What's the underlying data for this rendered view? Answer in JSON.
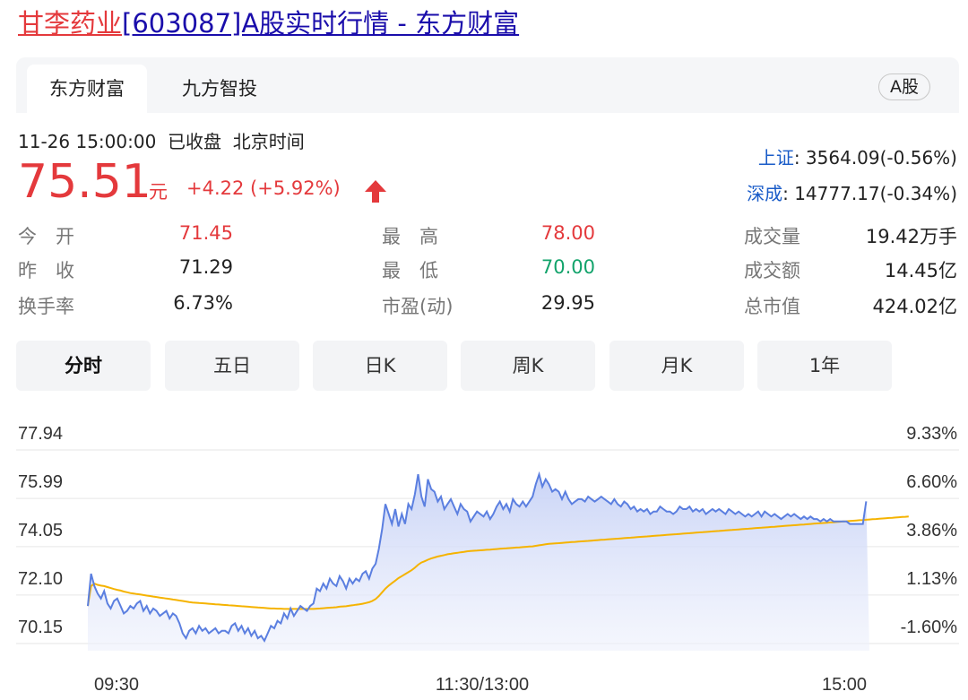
{
  "page_title": {
    "name_part": "甘李药业",
    "rest_part": "[603087]A股实时行情 - 东方财富"
  },
  "tabs": [
    {
      "label": "东方财富",
      "active": true
    },
    {
      "label": "九方智投",
      "active": false
    }
  ],
  "market_badge": "A股",
  "quote": {
    "timestamp": "11-26 15:00:00",
    "status": "已收盘",
    "timezone": "北京时间",
    "price": "75.51",
    "unit": "元",
    "change": "+4.22 (+5.92%)",
    "direction": "up"
  },
  "indices": [
    {
      "name": "上证",
      "value": ": 3564.09(-0.56%)"
    },
    {
      "name": "深成",
      "value": ": 14777.17(-0.34%)"
    }
  ],
  "stats": [
    {
      "label": "今　开",
      "value": "71.45",
      "tone": "red"
    },
    {
      "label": "最　高",
      "value": "78.00",
      "tone": "red"
    },
    {
      "label": "成交量",
      "value": "19.42万手",
      "tone": "normal"
    },
    {
      "label": "昨　收",
      "value": "71.29",
      "tone": "normal"
    },
    {
      "label": "最　低",
      "value": "70.00",
      "tone": "green"
    },
    {
      "label": "成交额",
      "value": "14.45亿",
      "tone": "normal"
    },
    {
      "label": "换手率",
      "value": "6.73%",
      "tone": "normal"
    },
    {
      "label": "市盈(动)",
      "value": "29.95",
      "tone": "normal"
    },
    {
      "label": "总市值",
      "value": "424.02亿",
      "tone": "normal"
    }
  ],
  "period_tabs": [
    {
      "label": "分时",
      "active": true
    },
    {
      "label": "五日",
      "active": false
    },
    {
      "label": "日K",
      "active": false
    },
    {
      "label": "周K",
      "active": false
    },
    {
      "label": "月K",
      "active": false
    },
    {
      "label": "1年",
      "active": false
    }
  ],
  "colors": {
    "up": "#e4393c",
    "down": "#12a36b",
    "price_line": "#5b7fe0",
    "avg_line": "#f5b300",
    "link_blue": "#1a5cc8"
  },
  "chart_data": {
    "type": "line",
    "y_ticks": [
      "77.94",
      "75.99",
      "74.05",
      "72.10",
      "70.15"
    ],
    "y_pct_ticks": [
      "9.33%",
      "6.60%",
      "3.86%",
      "1.13%",
      "-1.60%"
    ],
    "x_ticks": [
      "09:30",
      "11:30/13:00",
      "15:00"
    ],
    "ylim": [
      69.5,
      77.94
    ],
    "prev_close": 71.29,
    "points_count": 240,
    "series": [
      {
        "role": "price",
        "values": [
          71.3,
          72.6,
          72.1,
          71.8,
          71.6,
          71.9,
          71.4,
          71.2,
          71.5,
          71.6,
          71.3,
          71.0,
          71.1,
          71.3,
          71.2,
          71.4,
          71.5,
          71.1,
          71.3,
          71.0,
          71.2,
          71.1,
          70.9,
          71.0,
          71.1,
          70.8,
          71.0,
          70.9,
          70.6,
          70.2,
          70.0,
          70.3,
          70.4,
          70.2,
          70.5,
          70.3,
          70.4,
          70.2,
          70.3,
          70.4,
          70.2,
          70.3,
          70.3,
          70.2,
          70.5,
          70.6,
          70.3,
          70.5,
          70.2,
          70.4,
          70.1,
          70.3,
          70.0,
          70.1,
          69.9,
          70.2,
          70.5,
          70.4,
          70.7,
          70.6,
          71.0,
          70.8,
          71.2,
          70.9,
          71.1,
          71.3,
          71.2,
          71.1,
          71.3,
          71.4,
          72.0,
          71.9,
          72.2,
          72.0,
          72.4,
          72.2,
          72.1,
          72.5,
          72.3,
          72.0,
          72.4,
          72.2,
          72.4,
          72.3,
          72.6,
          72.7,
          72.4,
          72.8,
          73.0,
          73.6,
          74.4,
          75.4,
          75.0,
          74.6,
          75.2,
          74.5,
          75.0,
          74.6,
          75.4,
          75.2,
          75.8,
          76.6,
          75.7,
          75.3,
          76.4,
          76.0,
          75.9,
          75.5,
          75.7,
          75.2,
          75.4,
          75.6,
          75.3,
          75.0,
          75.4,
          75.2,
          75.1,
          74.7,
          74.9,
          75.1,
          75.0,
          74.9,
          75.1,
          74.8,
          75.0,
          75.3,
          75.5,
          75.2,
          75.4,
          75.1,
          75.6,
          75.4,
          75.3,
          75.5,
          75.3,
          75.5,
          75.7,
          76.2,
          76.6,
          76.1,
          76.4,
          76.2,
          75.9,
          76.0,
          75.9,
          75.6,
          75.9,
          75.6,
          75.4,
          75.5,
          75.6,
          75.6,
          75.5,
          75.7,
          75.6,
          75.5,
          75.6,
          75.7,
          75.6,
          75.5,
          75.4,
          75.6,
          75.4,
          75.3,
          75.5,
          75.4,
          75.2,
          75.3,
          75.1,
          75.2,
          75.1,
          75.2,
          75.0,
          75.1,
          75.1,
          75.3,
          75.2,
          75.1,
          75.1,
          75.0,
          75.1,
          75.3,
          75.2,
          75.2,
          75.3,
          75.1,
          75.2,
          75.1,
          75.2,
          75.0,
          75.1,
          75.2,
          75.1,
          75.2,
          75.1,
          75.0,
          75.2,
          75.1,
          75.0,
          75.1,
          75.0,
          74.9,
          75.0,
          74.9,
          75.0,
          75.1,
          74.9,
          75.1,
          75.0,
          74.9,
          75.0,
          74.9,
          74.8,
          74.9,
          75.0,
          74.9,
          75.0,
          74.9,
          74.8,
          74.9,
          74.8,
          74.9,
          74.8,
          74.8,
          74.7,
          74.8,
          74.7,
          74.8,
          74.7,
          74.7,
          74.7,
          74.7,
          74.7,
          74.6,
          74.6,
          74.6,
          74.6,
          74.6,
          75.51
        ]
      },
      {
        "role": "average",
        "values": [
          71.3,
          72.1,
          72.2,
          72.15,
          72.12,
          72.1,
          72.06,
          72.02,
          71.98,
          71.95,
          71.92,
          71.88,
          71.85,
          71.82,
          71.8,
          71.78,
          71.76,
          71.74,
          71.72,
          71.7,
          71.68,
          71.66,
          71.64,
          71.62,
          71.6,
          71.58,
          71.56,
          71.54,
          71.52,
          71.5,
          71.48,
          71.46,
          71.44,
          71.43,
          71.42,
          71.41,
          71.4,
          71.39,
          71.38,
          71.37,
          71.36,
          71.35,
          71.34,
          71.33,
          71.32,
          71.31,
          71.3,
          71.29,
          71.28,
          71.27,
          71.26,
          71.25,
          71.24,
          71.23,
          71.22,
          71.21,
          71.2,
          71.2,
          71.19,
          71.19,
          71.18,
          71.18,
          71.18,
          71.18,
          71.18,
          71.18,
          71.18,
          71.18,
          71.18,
          71.18,
          71.19,
          71.2,
          71.21,
          71.22,
          71.23,
          71.24,
          71.25,
          71.27,
          71.28,
          71.29,
          71.31,
          71.33,
          71.35,
          71.37,
          71.39,
          71.42,
          71.45,
          71.5,
          71.58,
          71.7,
          71.85,
          72.0,
          72.12,
          72.22,
          72.32,
          72.42,
          72.5,
          72.58,
          72.66,
          72.74,
          72.84,
          72.96,
          73.05,
          73.1,
          73.16,
          73.21,
          73.25,
          73.29,
          73.32,
          73.35,
          73.38,
          73.4,
          73.42,
          73.44,
          73.46,
          73.48,
          73.5,
          73.51,
          73.52,
          73.53,
          73.54,
          73.55,
          73.56,
          73.57,
          73.58,
          73.59,
          73.6,
          73.61,
          73.62,
          73.63,
          73.64,
          73.65,
          73.66,
          73.67,
          73.68,
          73.69,
          73.7,
          73.72,
          73.74,
          73.76,
          73.78,
          73.8,
          73.81,
          73.82,
          73.83,
          73.84,
          73.85,
          73.86,
          73.87,
          73.88,
          73.89,
          73.9,
          73.91,
          73.92,
          73.93,
          73.94,
          73.95,
          73.96,
          73.97,
          73.98,
          73.99,
          74.0,
          74.01,
          74.02,
          74.03,
          74.04,
          74.05,
          74.06,
          74.07,
          74.08,
          74.09,
          74.1,
          74.11,
          74.12,
          74.13,
          74.14,
          74.15,
          74.16,
          74.17,
          74.18,
          74.19,
          74.2,
          74.21,
          74.22,
          74.23,
          74.24,
          74.25,
          74.26,
          74.27,
          74.28,
          74.29,
          74.3,
          74.31,
          74.32,
          74.33,
          74.34,
          74.35,
          74.36,
          74.37,
          74.38,
          74.39,
          74.4,
          74.41,
          74.42,
          74.43,
          74.44,
          74.45,
          74.46,
          74.47,
          74.48,
          74.49,
          74.5,
          74.51,
          74.52,
          74.53,
          74.54,
          74.55,
          74.56,
          74.57,
          74.58,
          74.59,
          74.6,
          74.61,
          74.62,
          74.63,
          74.64,
          74.65,
          74.66,
          74.67,
          74.68,
          74.69,
          74.7,
          74.71,
          74.72,
          74.73,
          74.74,
          74.75,
          74.76,
          74.77,
          74.78,
          74.79,
          74.8,
          74.81,
          74.82,
          74.83,
          74.84,
          74.85,
          74.86,
          74.87,
          74.88,
          74.89,
          74.9
        ]
      }
    ]
  }
}
